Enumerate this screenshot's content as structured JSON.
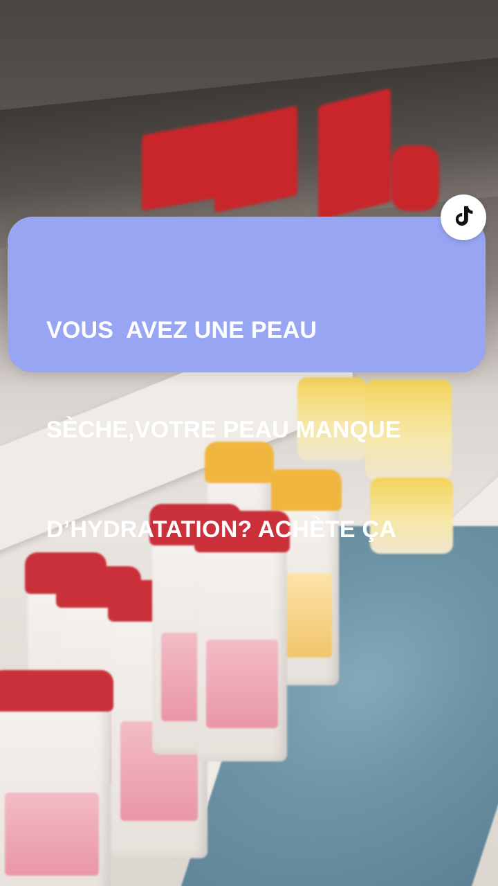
{
  "caption": {
    "line1": "VOUS  AVEZ UNE PEAU",
    "line2": "SÈCHE,VOTRE PEAU MANQUE",
    "line3": "D’HYDRATATION? ACHÈTE ÇA"
  },
  "badge": {
    "icon": "tiktok-logo-icon"
  },
  "colors": {
    "caption_background": "#98a5f2",
    "caption_text": "#ffffff",
    "badge_background": "#ffffff",
    "logo_color": "#111111"
  }
}
